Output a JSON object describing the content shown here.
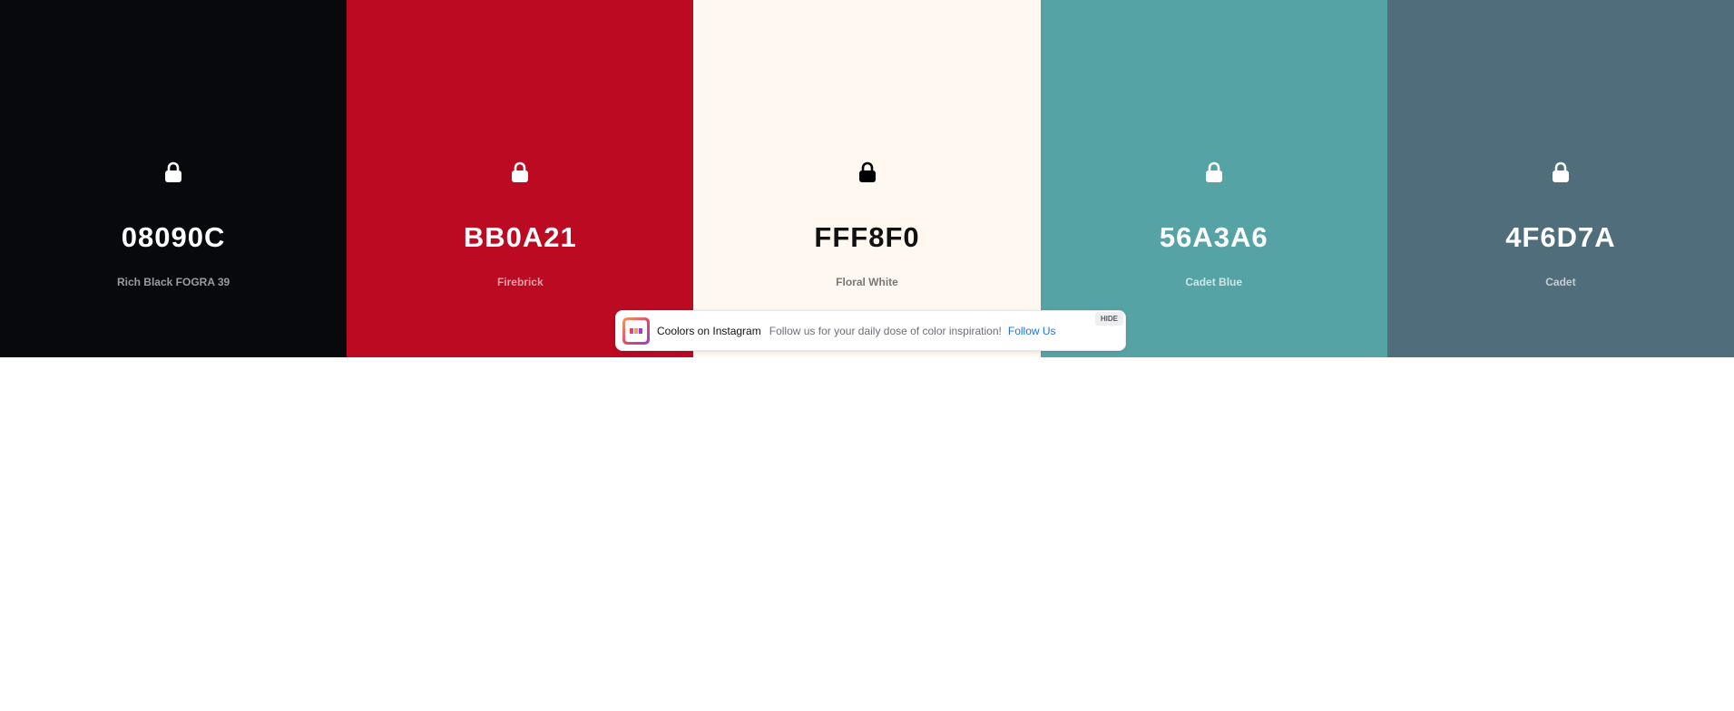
{
  "palette": {
    "swatches": [
      {
        "hex": "08090C",
        "name": "Rich Black FOGRA 39",
        "background": "#08090C",
        "hex_color": "#ffffff",
        "name_color": "#9a9ca1",
        "lock_color": "#ffffff",
        "lock_icon": "lock-icon"
      },
      {
        "hex": "BB0A21",
        "name": "Firebrick",
        "background": "#BB0A21",
        "hex_color": "#ffffff",
        "name_color": "#e8a3ac",
        "lock_color": "#ffffff",
        "lock_icon": "lock-icon"
      },
      {
        "hex": "FFF8F0",
        "name": "Floral White",
        "background": "#FFF8F0",
        "hex_color": "#111111",
        "name_color": "#7a7773",
        "lock_color": "#000000",
        "lock_icon": "lock-icon"
      },
      {
        "hex": "56A3A6",
        "name": "Cadet Blue",
        "background": "#56A3A6",
        "hex_color": "#ffffff",
        "name_color": "#cfe5e6",
        "lock_color": "#ffffff",
        "lock_icon": "lock-icon"
      },
      {
        "hex": "4F6D7A",
        "name": "Cadet",
        "background": "#4F6D7A",
        "hex_color": "#ffffff",
        "name_color": "#c4cfd4",
        "lock_color": "#ffffff",
        "lock_icon": "lock-icon"
      }
    ]
  },
  "toast": {
    "title": "Coolors on Instagram",
    "text": "Follow us for your daily dose of color inspiration!",
    "link": "Follow Us",
    "hide": "HIDE",
    "logo_icon": "instagram-logo-icon",
    "link_color": "#1f74e6"
  }
}
